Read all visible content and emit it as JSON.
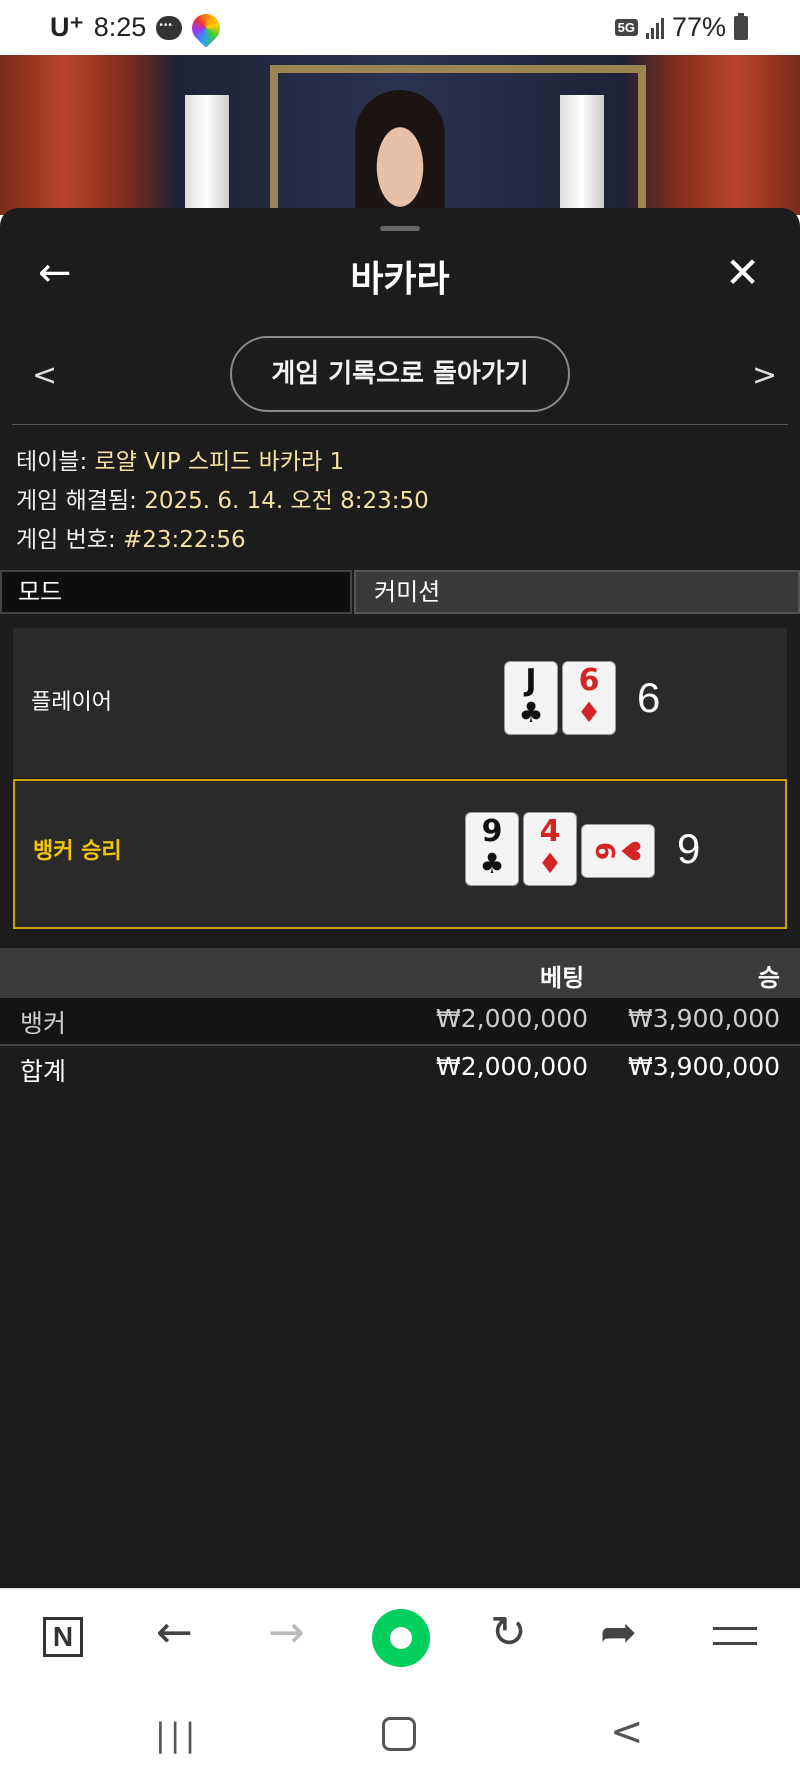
{
  "status_bar": {
    "carrier": "U⁺",
    "time": "8:25",
    "network": "5G",
    "battery": "77%"
  },
  "sheet": {
    "title": "바카라",
    "back_to_history": "게임 기록으로 돌아가기",
    "info": {
      "table_label": "테이블:",
      "table_value": "로얄 VIP 스피드 바카라 1",
      "resolved_label": "게임 해결됨:",
      "resolved_value": "2025. 6. 14. 오전 8:23:50",
      "game_no_label": "게임 번호:",
      "game_no_value": "#23:22:56"
    },
    "mode": {
      "label": "모드",
      "value": "커미션"
    },
    "hands": {
      "player": {
        "label": "플레이어",
        "score": "6",
        "cards": [
          {
            "rank": "J",
            "suit": "♣"
          },
          {
            "rank": "6",
            "suit": "♦"
          }
        ]
      },
      "banker": {
        "label": "뱅커 승리",
        "score": "9",
        "cards": [
          {
            "rank": "9",
            "suit": "♣"
          },
          {
            "rank": "4",
            "suit": "♦"
          },
          {
            "rank": "6",
            "suit": "♥"
          }
        ]
      }
    },
    "bets_table": {
      "headers": {
        "bet": "베팅",
        "win": "승"
      },
      "rows": [
        {
          "name": "뱅커",
          "bet": "₩2,000,000",
          "win": "₩3,900,000"
        }
      ],
      "total": {
        "name": "합계",
        "bet": "₩2,000,000",
        "win": "₩3,900,000"
      }
    }
  },
  "browser_toolbar": {
    "items": [
      "n-logo-icon",
      "back-arrow-icon",
      "forward-arrow-icon",
      "home-icon",
      "refresh-icon",
      "share-icon",
      "menu-icon"
    ],
    "n_label": "N"
  },
  "colors": {
    "accent_win": "#f1c40f",
    "sheet_bg": "#1c1c1c",
    "home_green": "#03cf5d"
  }
}
